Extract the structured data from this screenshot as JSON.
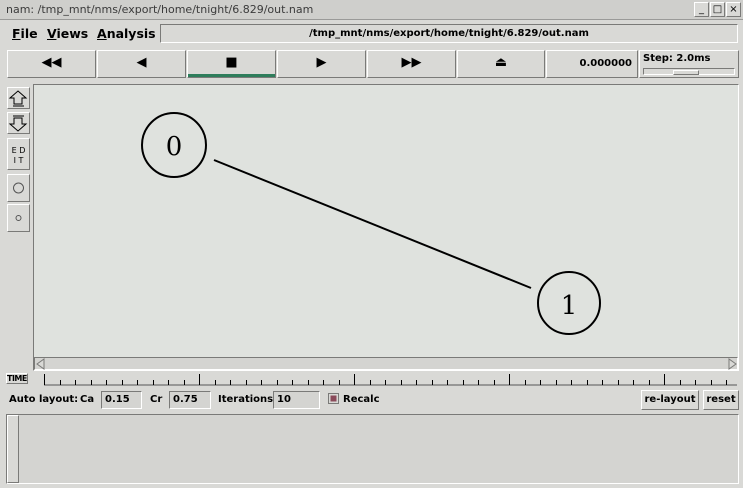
{
  "window": {
    "title": "nam: /tmp_mnt/nms/export/home/tnight/6.829/out.nam",
    "buttons": [
      "_",
      "□",
      "×"
    ]
  },
  "menubar": {
    "items": [
      {
        "label": "File",
        "underline": "F",
        "rest": "ile"
      },
      {
        "label": "Views",
        "underline": "V",
        "rest": "iews"
      },
      {
        "label": "Analysis",
        "underline": "A",
        "rest": "nalysis"
      }
    ],
    "path": "/tmp_mnt/nms/export/home/tnight/6.829/out.nam"
  },
  "controls": {
    "rewind": "◀◀",
    "back": "◀",
    "stop": "■",
    "play": "▶",
    "fastforward": "▶▶",
    "eject": "⏏",
    "time": "0.000000",
    "step_label": "Step: 2.0ms",
    "step_position": 0.45
  },
  "toolbar": {
    "edit_label": "E D\nI T"
  },
  "graph": {
    "nodes": [
      {
        "id": "0",
        "label": "0"
      },
      {
        "id": "1",
        "label": "1"
      }
    ],
    "links": [
      {
        "from": "0",
        "to": "1"
      }
    ]
  },
  "timeline": {
    "label": "TIME"
  },
  "autolayout": {
    "label": "Auto layout:",
    "ca_label": "Ca",
    "ca_value": "0.15",
    "cr_label": "Cr",
    "cr_value": "0.75",
    "iter_label": "Iterations",
    "iter_value": "10",
    "recalc_label": "Recalc",
    "recalc_checked": true,
    "relayout_label": "re-layout",
    "reset_label": "reset"
  },
  "colors": {
    "active_indicator": "#2e7d5b",
    "recalc_check": "#8a4a5a"
  }
}
